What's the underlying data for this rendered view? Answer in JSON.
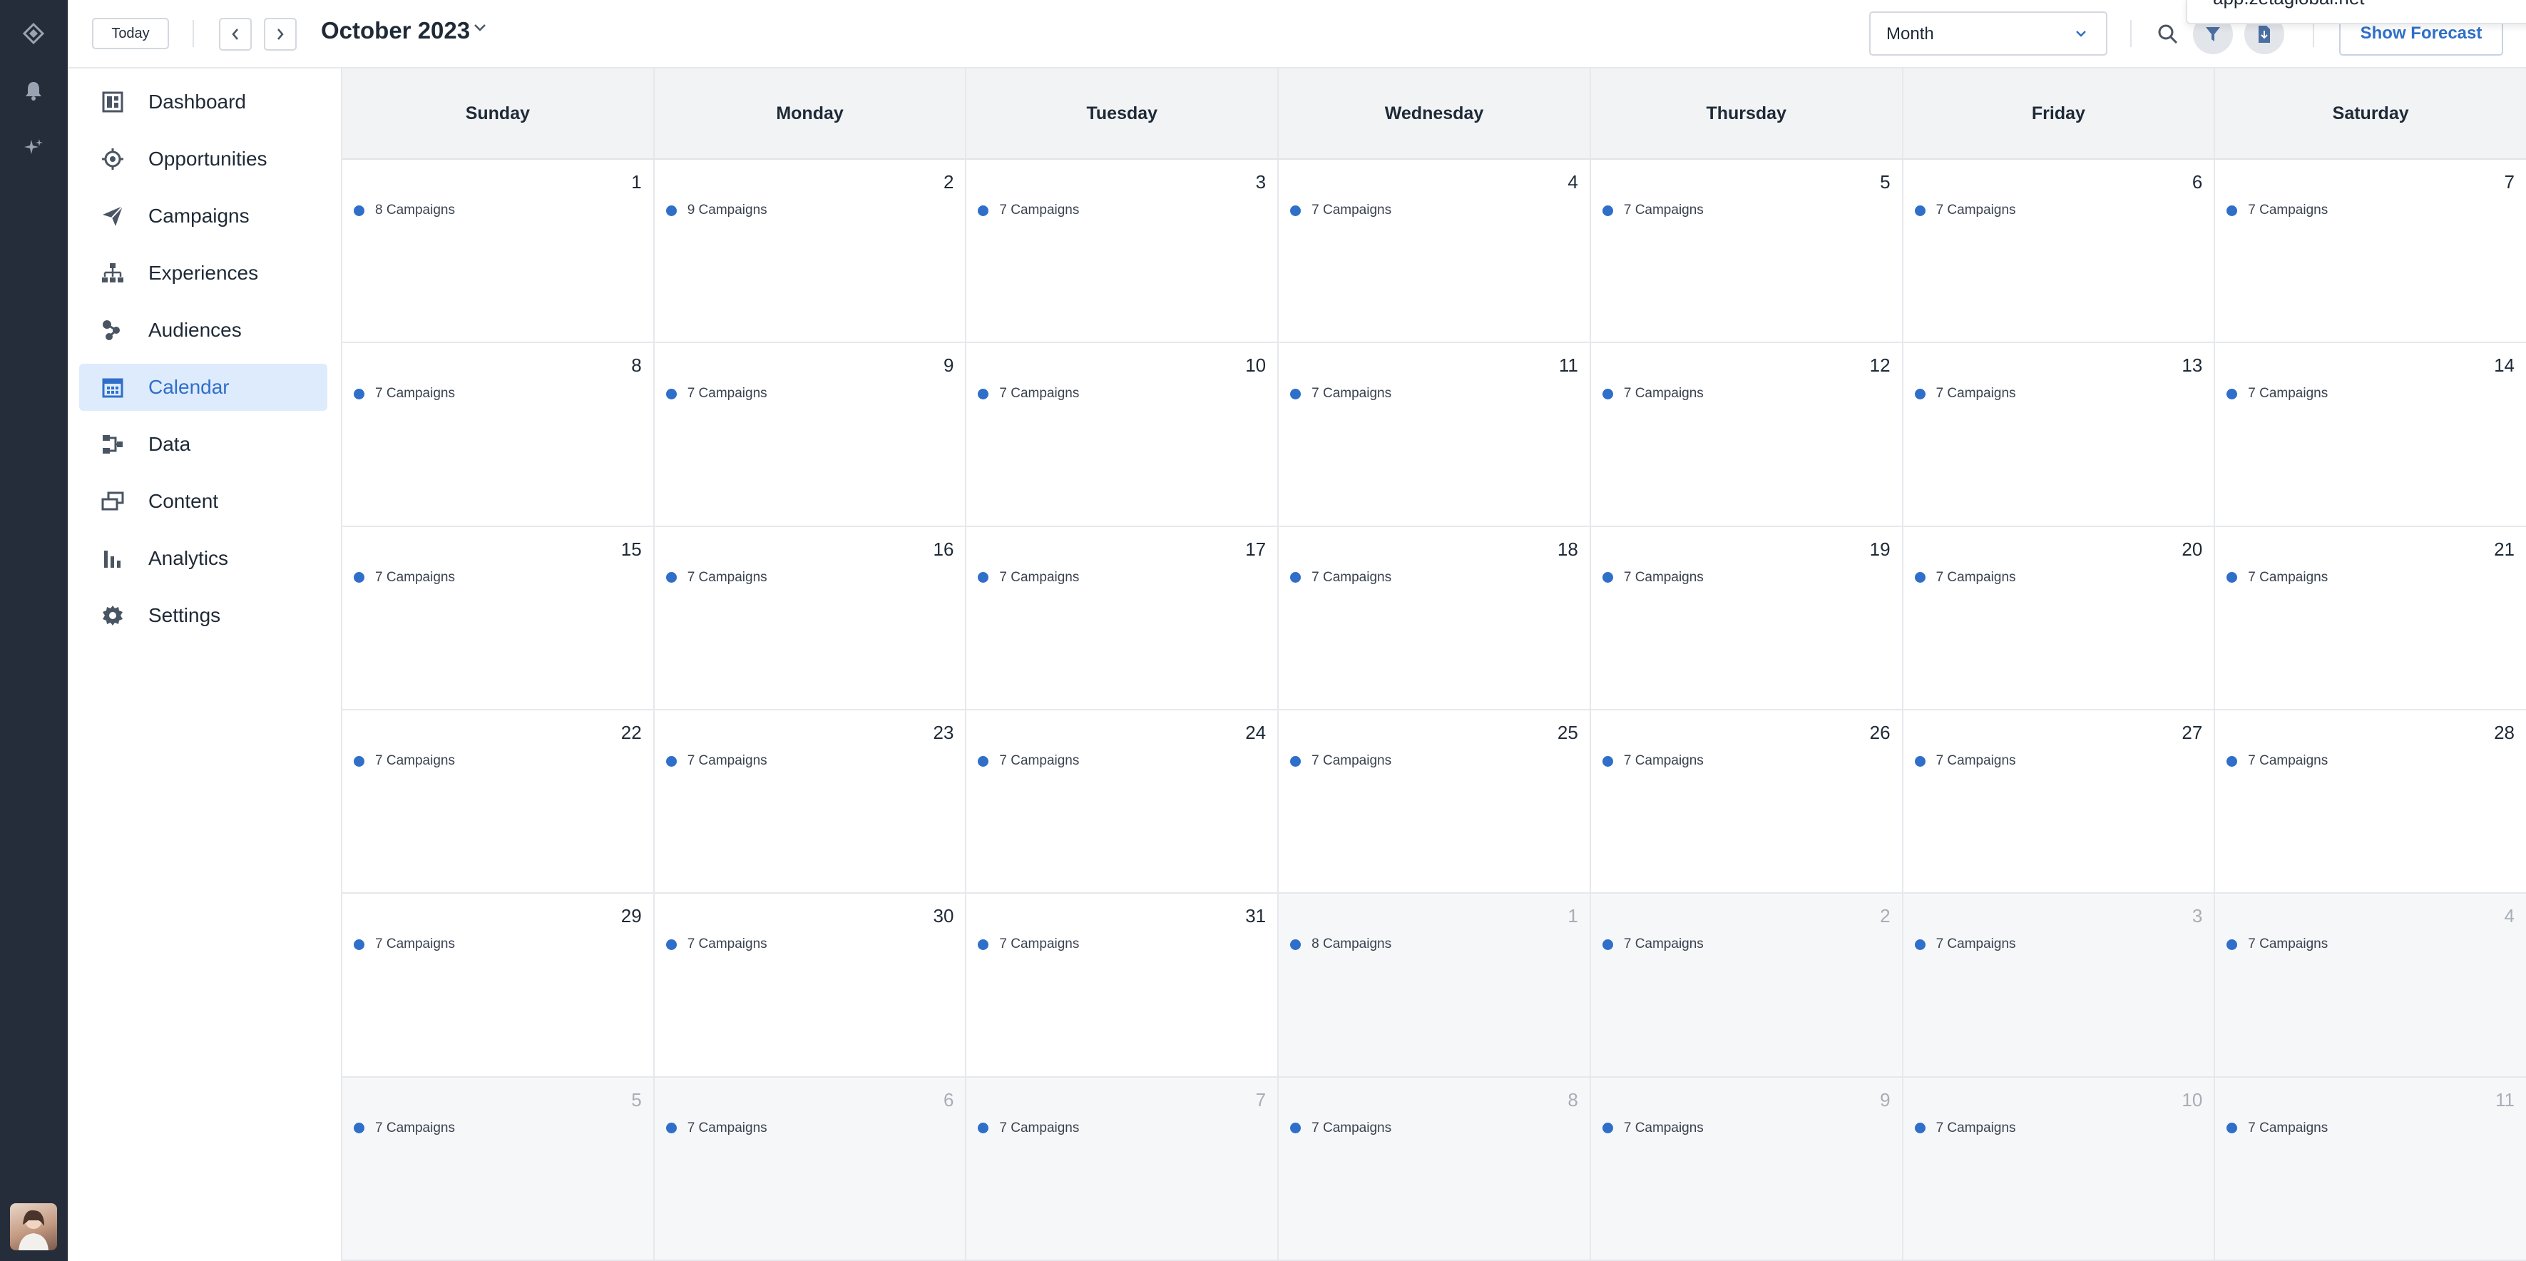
{
  "topbar": {
    "today_label": "Today",
    "title": "October 2023",
    "view_select": {
      "value": "Month"
    },
    "forecast_label": "Show Forecast",
    "popup_text": "app.zetaglobal.net"
  },
  "sidebar": {
    "items": [
      {
        "label": "Dashboard",
        "icon": "dashboard-icon",
        "active": false
      },
      {
        "label": "Opportunities",
        "icon": "target-icon",
        "active": false
      },
      {
        "label": "Campaigns",
        "icon": "paper-plane-icon",
        "active": false
      },
      {
        "label": "Experiences",
        "icon": "hierarchy-icon",
        "active": false
      },
      {
        "label": "Audiences",
        "icon": "audience-icon",
        "active": false
      },
      {
        "label": "Calendar",
        "icon": "calendar-icon",
        "active": true
      },
      {
        "label": "Data",
        "icon": "data-icon",
        "active": false
      },
      {
        "label": "Content",
        "icon": "content-icon",
        "active": false
      },
      {
        "label": "Analytics",
        "icon": "bar-chart-icon",
        "active": false
      },
      {
        "label": "Settings",
        "icon": "gear-icon",
        "active": false
      }
    ]
  },
  "calendar": {
    "weekdays": [
      "Sunday",
      "Monday",
      "Tuesday",
      "Wednesday",
      "Thursday",
      "Friday",
      "Saturday"
    ],
    "cells": [
      {
        "date": "1",
        "label": "8 Campaigns",
        "other": false
      },
      {
        "date": "2",
        "label": "9 Campaigns",
        "other": false
      },
      {
        "date": "3",
        "label": "7 Campaigns",
        "other": false
      },
      {
        "date": "4",
        "label": "7 Campaigns",
        "other": false
      },
      {
        "date": "5",
        "label": "7 Campaigns",
        "other": false
      },
      {
        "date": "6",
        "label": "7 Campaigns",
        "other": false
      },
      {
        "date": "7",
        "label": "7 Campaigns",
        "other": false
      },
      {
        "date": "8",
        "label": "7 Campaigns",
        "other": false
      },
      {
        "date": "9",
        "label": "7 Campaigns",
        "other": false
      },
      {
        "date": "10",
        "label": "7 Campaigns",
        "other": false
      },
      {
        "date": "11",
        "label": "7 Campaigns",
        "other": false
      },
      {
        "date": "12",
        "label": "7 Campaigns",
        "other": false
      },
      {
        "date": "13",
        "label": "7 Campaigns",
        "other": false
      },
      {
        "date": "14",
        "label": "7 Campaigns",
        "other": false
      },
      {
        "date": "15",
        "label": "7 Campaigns",
        "other": false
      },
      {
        "date": "16",
        "label": "7 Campaigns",
        "other": false
      },
      {
        "date": "17",
        "label": "7 Campaigns",
        "other": false
      },
      {
        "date": "18",
        "label": "7 Campaigns",
        "other": false
      },
      {
        "date": "19",
        "label": "7 Campaigns",
        "other": false
      },
      {
        "date": "20",
        "label": "7 Campaigns",
        "other": false
      },
      {
        "date": "21",
        "label": "7 Campaigns",
        "other": false
      },
      {
        "date": "22",
        "label": "7 Campaigns",
        "other": false
      },
      {
        "date": "23",
        "label": "7 Campaigns",
        "other": false
      },
      {
        "date": "24",
        "label": "7 Campaigns",
        "other": false
      },
      {
        "date": "25",
        "label": "7 Campaigns",
        "other": false
      },
      {
        "date": "26",
        "label": "7 Campaigns",
        "other": false
      },
      {
        "date": "27",
        "label": "7 Campaigns",
        "other": false
      },
      {
        "date": "28",
        "label": "7 Campaigns",
        "other": false
      },
      {
        "date": "29",
        "label": "7 Campaigns",
        "other": false
      },
      {
        "date": "30",
        "label": "7 Campaigns",
        "other": false
      },
      {
        "date": "31",
        "label": "7 Campaigns",
        "other": false
      },
      {
        "date": "1",
        "label": "8 Campaigns",
        "other": true
      },
      {
        "date": "2",
        "label": "7 Campaigns",
        "other": true
      },
      {
        "date": "3",
        "label": "7 Campaigns",
        "other": true
      },
      {
        "date": "4",
        "label": "7 Campaigns",
        "other": true
      },
      {
        "date": "5",
        "label": "7 Campaigns",
        "other": true
      },
      {
        "date": "6",
        "label": "7 Campaigns",
        "other": true
      },
      {
        "date": "7",
        "label": "7 Campaigns",
        "other": true
      },
      {
        "date": "8",
        "label": "7 Campaigns",
        "other": true
      },
      {
        "date": "9",
        "label": "7 Campaigns",
        "other": true
      },
      {
        "date": "10",
        "label": "7 Campaigns",
        "other": true
      },
      {
        "date": "11",
        "label": "7 Campaigns",
        "other": true
      }
    ]
  },
  "colors": {
    "accent": "#2f6fc9",
    "rail": "#262d3a",
    "active_nav_bg": "#ddebfd",
    "event_dot": "#2f6fc9"
  }
}
